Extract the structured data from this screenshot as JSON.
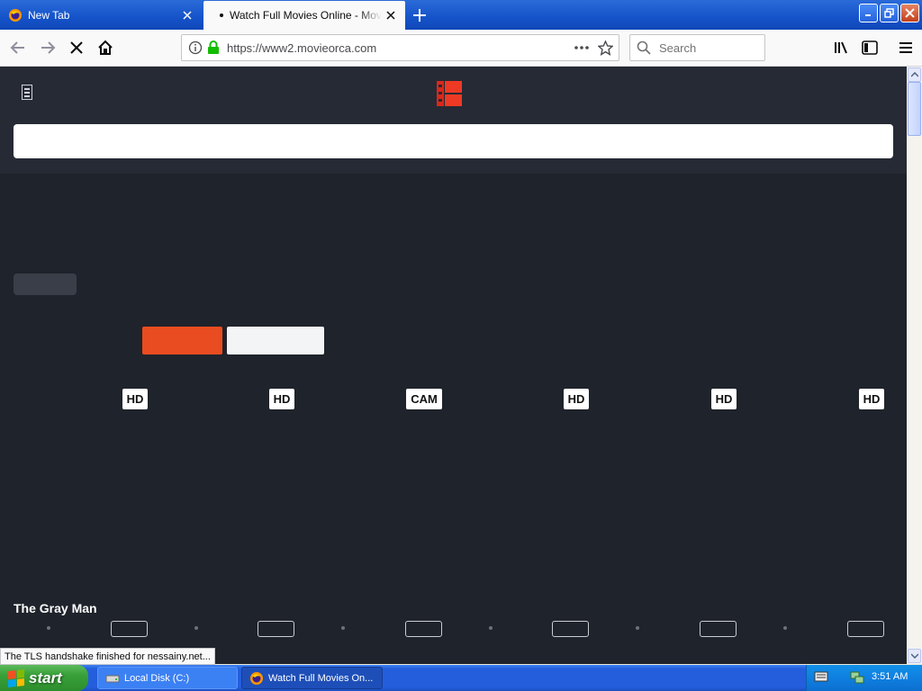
{
  "browser": {
    "tabs": [
      {
        "title": "New Tab",
        "active": false
      },
      {
        "title": "Watch Full Movies Online - MovieOrca",
        "active": true
      }
    ],
    "url": "https://www2.movieorca.com",
    "search_placeholder": "Search",
    "status_text": "The TLS handshake finished for nessainy.net..."
  },
  "page": {
    "quality_badges": [
      "HD",
      "HD",
      "CAM",
      "HD",
      "HD",
      "HD"
    ],
    "movie_title": "The Gray Man",
    "colors": {
      "accent": "#e94c20",
      "header_bg": "#262a35",
      "body_bg": "#1f232b"
    }
  },
  "taskbar": {
    "start_label": "start",
    "tasks": [
      {
        "label": "Local Disk (C:)",
        "active": false
      },
      {
        "label": "Watch Full Movies On...",
        "active": true
      }
    ],
    "clock": "3:51 AM"
  }
}
